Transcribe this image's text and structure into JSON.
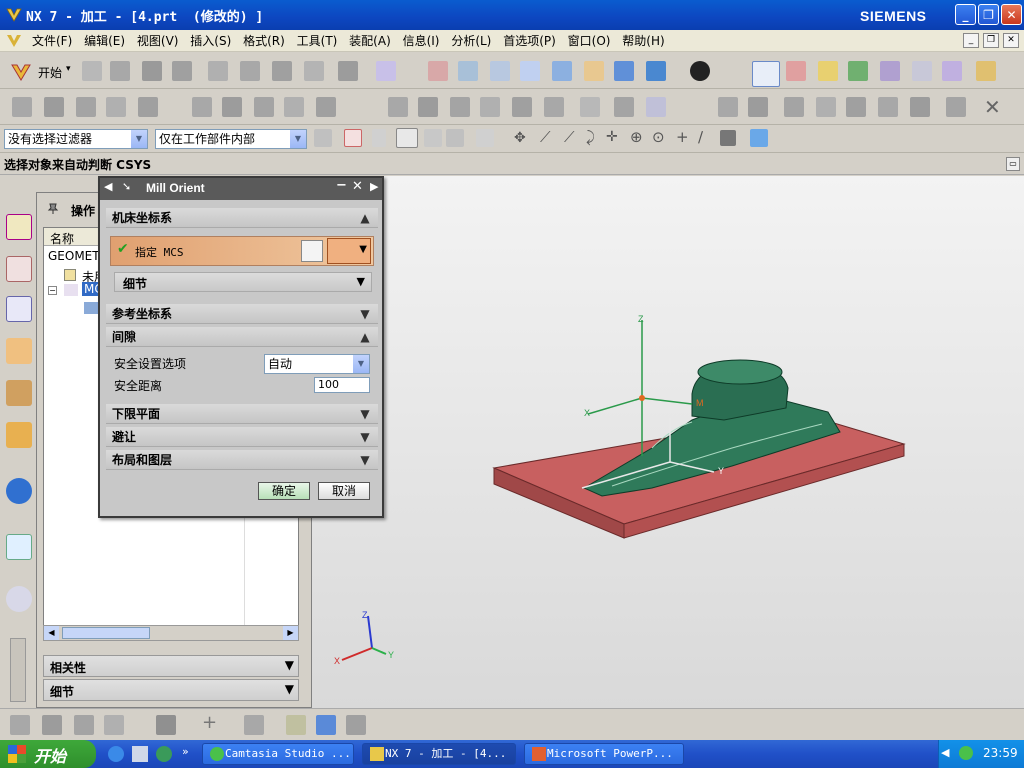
{
  "window": {
    "title": "NX 7 - 加工 - [4.prt  (修改的) ]",
    "brand": "SIEMENS"
  },
  "menubar": {
    "items": [
      "文件(F)",
      "编辑(E)",
      "视图(V)",
      "插入(S)",
      "格式(R)",
      "工具(T)",
      "装配(A)",
      "信息(I)",
      "分析(L)",
      "首选项(P)",
      "窗口(O)",
      "帮助(H)"
    ]
  },
  "toolbar": {
    "start_label": "开始"
  },
  "selection_bar": {
    "filter_value": "没有选择过滤器",
    "scope_value": "仅在工作部件内部"
  },
  "cue_line": {
    "text": "选择对象来自动判断 CSYS"
  },
  "navigator": {
    "title": "操作",
    "column_name": "名称",
    "rows": [
      "GEOMETR",
      "未用",
      "MC"
    ],
    "sections": [
      "相关性",
      "细节"
    ]
  },
  "dialog": {
    "title": "Mill Orient",
    "sections": {
      "machine_csys": "机床坐标系",
      "specify_mcs": "指定 MCS",
      "details": "细节",
      "ref_csys": "参考坐标系",
      "clearance": "间隙",
      "lower_plane": "下限平面",
      "avoidance": "避让",
      "layout_layer": "布局和图层"
    },
    "fields": {
      "safety_option_label": "安全设置选项",
      "safety_option_value": "自动",
      "safety_distance_label": "安全距离",
      "safety_distance_value": "100"
    },
    "buttons": {
      "ok": "确定",
      "cancel": "取消"
    }
  },
  "triad_labels": {
    "x": "X",
    "y": "Y",
    "z": "Z",
    "origin": "M"
  },
  "taskbar": {
    "start": "开始",
    "tasks": [
      "Camtasia Studio ...",
      "NX 7 - 加工 - [4...",
      "Microsoft PowerP..."
    ],
    "clock": "23:59"
  },
  "colors": {
    "title_blue": "#0d46c0",
    "part_green": "#2f7a5a",
    "block_red": "#c45858",
    "dialog_gray": "#c8c8c8",
    "mcs_orange": "#e0a070"
  }
}
